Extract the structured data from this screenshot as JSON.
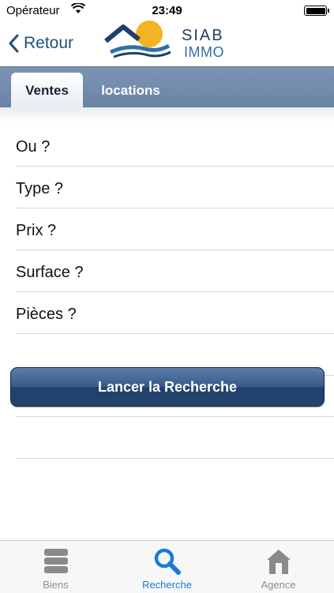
{
  "status": {
    "carrier": "Opérateur",
    "time": "23:49"
  },
  "nav": {
    "back_label": "Retour",
    "logo_line1": "SIAB",
    "logo_line2": "IMMO"
  },
  "segments": [
    {
      "label": "Ventes",
      "selected": true
    },
    {
      "label": "locations",
      "selected": false
    }
  ],
  "criteria": [
    {
      "label": "Ou ?"
    },
    {
      "label": "Type ?"
    },
    {
      "label": "Prix ?"
    },
    {
      "label": "Surface ?"
    },
    {
      "label": "Pièces ?"
    }
  ],
  "search_button_label": "Lancer la Recherche",
  "tab_bar": [
    {
      "label": "Biens",
      "icon": "database-icon",
      "active": false
    },
    {
      "label": "Recherche",
      "icon": "search-icon",
      "active": true
    },
    {
      "label": "Agence",
      "icon": "house-icon",
      "active": false
    }
  ],
  "colors": {
    "accent": "#1a7ad8",
    "segment_bar": "#7188aa",
    "button": "#2f4f7e",
    "back": "#1f4f7a"
  }
}
